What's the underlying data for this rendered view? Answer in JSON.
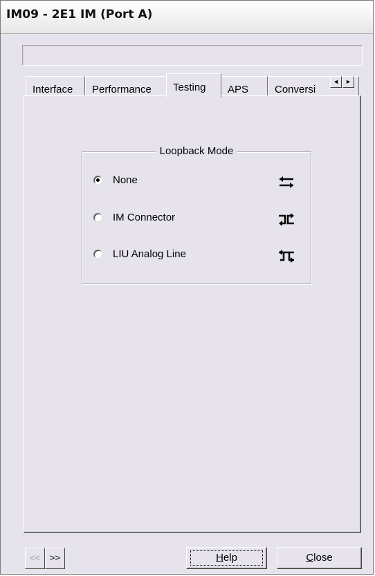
{
  "window": {
    "title": "IM09 - 2E1 IM (Port A)"
  },
  "status_field": {
    "value": ""
  },
  "tabs": [
    {
      "label": "Interface",
      "active": false
    },
    {
      "label": "Performance",
      "active": false
    },
    {
      "label": "Testing",
      "active": true
    },
    {
      "label": "APS",
      "active": false
    },
    {
      "label": "Conversi",
      "active": false
    }
  ],
  "tab_scroll": {
    "left": "◄",
    "right": "►"
  },
  "loopback": {
    "legend": "Loopback Mode",
    "selected": "None",
    "options": [
      {
        "label": "None",
        "icon": "loopback-none-icon"
      },
      {
        "label": "IM Connector",
        "icon": "loopback-im-connector-icon"
      },
      {
        "label": "LIU Analog Line",
        "icon": "loopback-liu-line-icon"
      }
    ]
  },
  "buttons": {
    "prev": "<<",
    "next": ">>",
    "help_mnemonic": "H",
    "help_rest": "elp",
    "close_mnemonic": "C",
    "close_rest": "lose"
  }
}
